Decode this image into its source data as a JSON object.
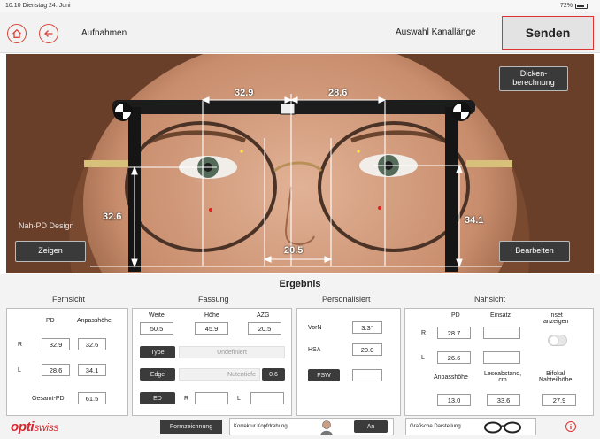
{
  "status_bar": {
    "time": "10:10  Dienstag 24. Juni",
    "battery": "72%"
  },
  "header": {
    "title": "Aufnahmen",
    "channel_label": "Auswahl Kanallänge",
    "send_label": "Senden"
  },
  "photo": {
    "dims": {
      "pd_right": "32.9",
      "pd_left": "28.6",
      "height_right": "32.6",
      "height_left": "34.1",
      "bridge": "20.5"
    },
    "nah_pd_label": "Nah-PD Design",
    "buttons": {
      "dicken": "Dicken-\nberechnung",
      "zeigen": "Zeigen",
      "bearbeiten": "Bearbeiten"
    }
  },
  "results": {
    "title": "Ergebnis",
    "fernsicht": {
      "title": "Fernsicht",
      "pd_label": "PD",
      "height_label": "Anpasshöhe",
      "r_label": "R",
      "l_label": "L",
      "r_pd": "32.9",
      "r_height": "32.6",
      "l_pd": "28.6",
      "l_height": "34.1",
      "total_label": "Gesamt-PD",
      "total": "61.5"
    },
    "fassung": {
      "title": "Fassung",
      "weite_label": "Weite",
      "hoehe_label": "Höhe",
      "azg_label": "AZG",
      "weite": "50.5",
      "hoehe": "45.9",
      "azg": "20.5",
      "type_btn": "Type",
      "type_value": "Undefiniert",
      "edge_btn": "Edge",
      "nut_label": "Nutentiefe",
      "nut_value": "0.6",
      "ed_btn": "ED",
      "r_label": "R",
      "l_label": "L",
      "ed_r": "",
      "ed_l": ""
    },
    "personalisiert": {
      "title": "Personalisiert",
      "vorn_label": "VorN",
      "vorn": "3.3°",
      "hsa_label": "HSA",
      "hsa": "20.0",
      "fsw_btn": "FSW",
      "fsw": ""
    },
    "nahsicht": {
      "title": "Nahsicht",
      "pd_label": "PD",
      "einsatz_label": "Einsatz",
      "inset_label": "Inset\nanzeigen",
      "r_label": "R",
      "l_label": "L",
      "r_pd": "28.7",
      "r_einsatz": "",
      "l_pd": "26.6",
      "l_einsatz": "",
      "anpass_label": "Anpasshöhe",
      "lese_label": "Leseabstand,\ncm",
      "bifokal_label": "Bifokal\nNahteilhöhe",
      "anpass": "13.0",
      "lese": "33.6",
      "bifokal": "27.9"
    }
  },
  "footer": {
    "logo_opti": "opti",
    "logo_swiss": "swiss",
    "formzeichnung": "Formzeichnung",
    "korrektur_label": "Korrektur Kopfdrehung",
    "korrektur_btn": "An",
    "grafische_label": "Grafische Darstellung",
    "info": "i"
  },
  "colors": {
    "accent": "#d9463a",
    "dark_button": "#3b3b3b",
    "logo_red": "#d8262e"
  }
}
